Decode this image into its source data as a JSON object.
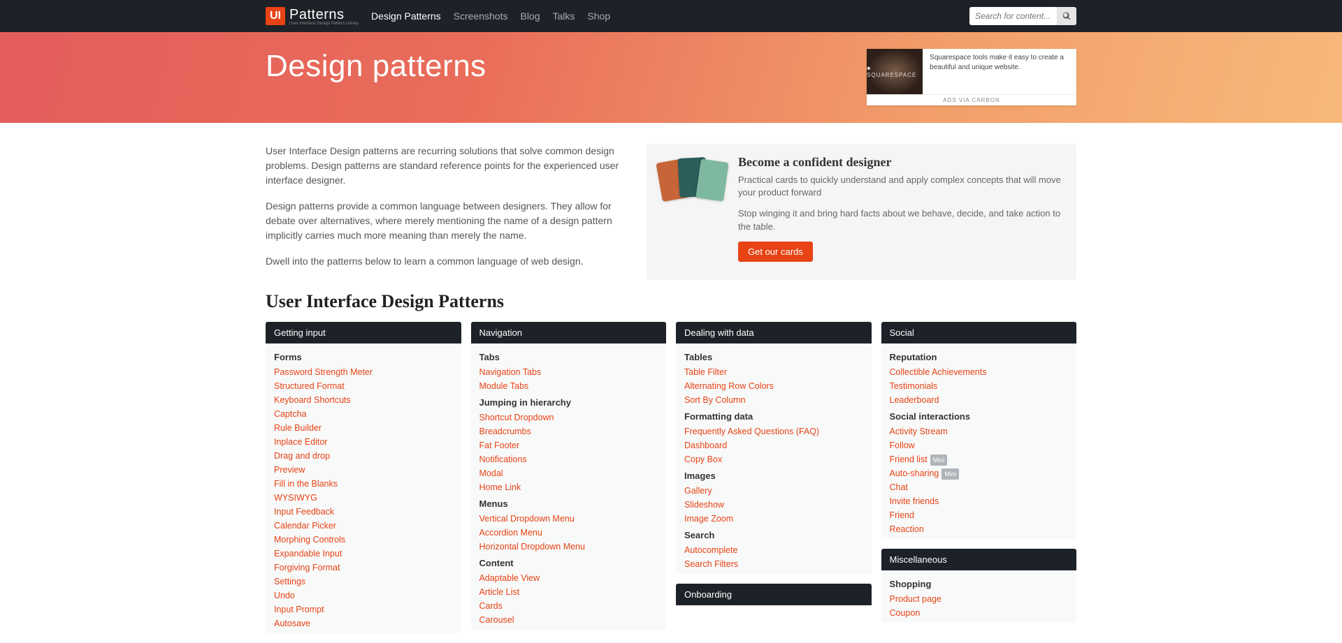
{
  "nav": {
    "logo_badge": "UI",
    "logo_text": "Patterns",
    "logo_sub": "User Interface Design Pattern Library",
    "links": [
      {
        "label": "Design Patterns",
        "active": true
      },
      {
        "label": "Screenshots",
        "active": false
      },
      {
        "label": "Blog",
        "active": false
      },
      {
        "label": "Talks",
        "active": false
      },
      {
        "label": "Shop",
        "active": false
      }
    ],
    "search_placeholder": "Search for content..."
  },
  "hero": {
    "title": "Design patterns"
  },
  "ad": {
    "brand": "⬥ SQUARESPACE",
    "text": "Squarespace tools make it easy to create a beautiful and unique website.",
    "footer": "ADS VIA CARBON"
  },
  "intro": {
    "p1": "User Interface Design patterns are recurring solutions that solve common design problems. Design patterns are standard reference points for the experienced user interface designer.",
    "p2": "Design patterns provide a common language between designers. They allow for debate over alternatives, where merely mentioning the name of a design pattern implicitly carries much more meaning than merely the name.",
    "p3": "Dwell into the patterns below to learn a common language of web design."
  },
  "promo": {
    "title": "Become a confident designer",
    "p1": "Practical cards to quickly understand and apply complex concepts that will move your product forward",
    "p2": "Stop winging it and bring hard facts about we behave, decide, and take action to the table.",
    "btn": "Get our cards"
  },
  "section_title": "User Interface Design Patterns",
  "columns": [
    {
      "panels": [
        {
          "header": "Getting input",
          "groups": [
            {
              "title": "Forms",
              "items": [
                "Password Strength Meter",
                "Structured Format",
                "Keyboard Shortcuts",
                "Captcha",
                "Rule Builder",
                "Inplace Editor",
                "Drag and drop",
                "Preview",
                "Fill in the Blanks",
                "WYSIWYG",
                "Input Feedback",
                "Calendar Picker",
                "Morphing Controls",
                "Expandable Input",
                "Forgiving Format",
                "Settings",
                "Undo",
                "Input Prompt",
                "Autosave"
              ]
            }
          ]
        }
      ]
    },
    {
      "panels": [
        {
          "header": "Navigation",
          "groups": [
            {
              "title": "Tabs",
              "items": [
                "Navigation Tabs",
                "Module Tabs"
              ]
            },
            {
              "title": "Jumping in hierarchy",
              "items": [
                "Shortcut Dropdown",
                "Breadcrumbs",
                "Fat Footer",
                "Notifications",
                "Modal",
                "Home Link"
              ]
            },
            {
              "title": "Menus",
              "items": [
                "Vertical Dropdown Menu",
                "Accordion Menu",
                "Horizontal Dropdown Menu"
              ]
            },
            {
              "title": "Content",
              "items": [
                "Adaptable View",
                "Article List",
                "Cards",
                "Carousel"
              ]
            }
          ]
        }
      ]
    },
    {
      "panels": [
        {
          "header": "Dealing with data",
          "groups": [
            {
              "title": "Tables",
              "items": [
                "Table Filter",
                "Alternating Row Colors",
                "Sort By Column"
              ]
            },
            {
              "title": "Formatting data",
              "items": [
                "Frequently Asked Questions (FAQ)",
                "Dashboard",
                "Copy Box"
              ]
            },
            {
              "title": "Images",
              "items": [
                "Gallery",
                "Slideshow",
                "Image Zoom"
              ]
            },
            {
              "title": "Search",
              "items": [
                "Autocomplete",
                "Search Filters"
              ]
            }
          ]
        },
        {
          "header": "Onboarding",
          "groups": []
        }
      ]
    },
    {
      "panels": [
        {
          "header": "Social",
          "groups": [
            {
              "title": "Reputation",
              "items": [
                "Collectible Achievements",
                "Testimonials",
                "Leaderboard"
              ]
            },
            {
              "title": "Social interactions",
              "items": [
                "Activity Stream",
                "Follow",
                {
                  "label": "Friend list",
                  "badge": "Mini"
                },
                {
                  "label": "Auto-sharing",
                  "badge": "Mini"
                },
                "Chat",
                "Invite friends",
                "Friend",
                "Reaction"
              ]
            }
          ]
        },
        {
          "header": "Miscellaneous",
          "groups": [
            {
              "title": "Shopping",
              "items": [
                "Product page",
                "Coupon"
              ]
            }
          ]
        }
      ]
    }
  ]
}
